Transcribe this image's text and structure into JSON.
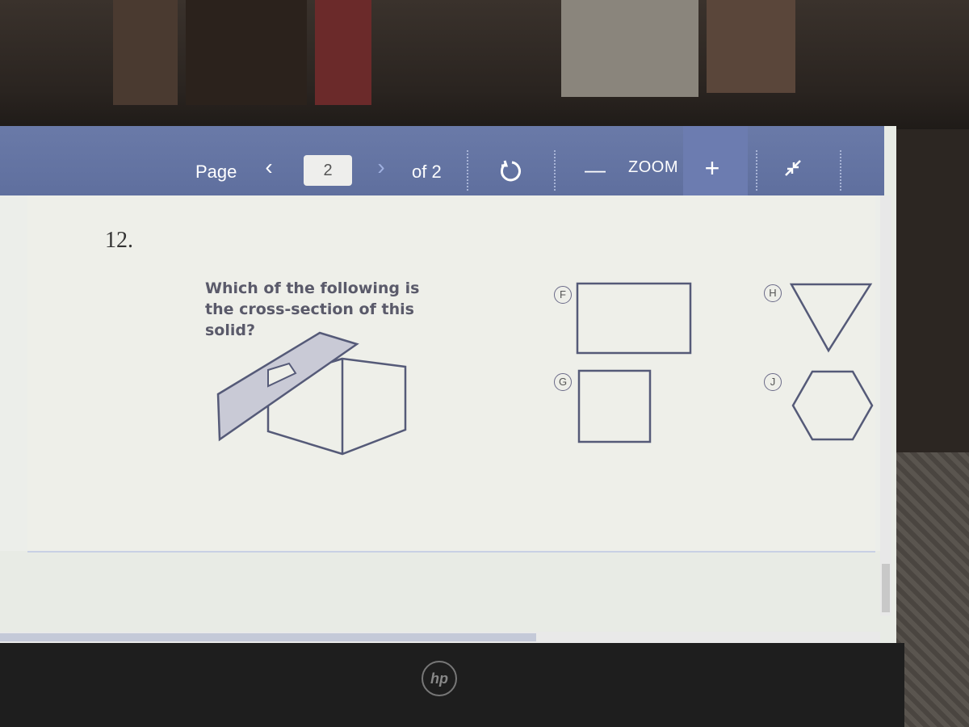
{
  "toolbar": {
    "page_label": "Page",
    "prev_icon": "chevron-left-icon",
    "prev_glyph": "‹",
    "current_page": "2",
    "next_icon": "chevron-right-icon",
    "next_glyph": "›",
    "of_label": "of 2",
    "refresh_icon": "rotate-icon",
    "zoom_out_glyph": "—",
    "zoom_label": "ZOOM",
    "zoom_in_glyph": "+",
    "collapse_icon": "collapse-arrows-icon"
  },
  "question": {
    "number": "12.",
    "text": "Which of the following is the cross-section of this solid?",
    "choices": [
      {
        "label": "F",
        "shape": "rectangle"
      },
      {
        "label": "G",
        "shape": "square"
      },
      {
        "label": "H",
        "shape": "triangle"
      },
      {
        "label": "J",
        "shape": "hexagon"
      }
    ]
  },
  "device": {
    "logo": "hp"
  }
}
